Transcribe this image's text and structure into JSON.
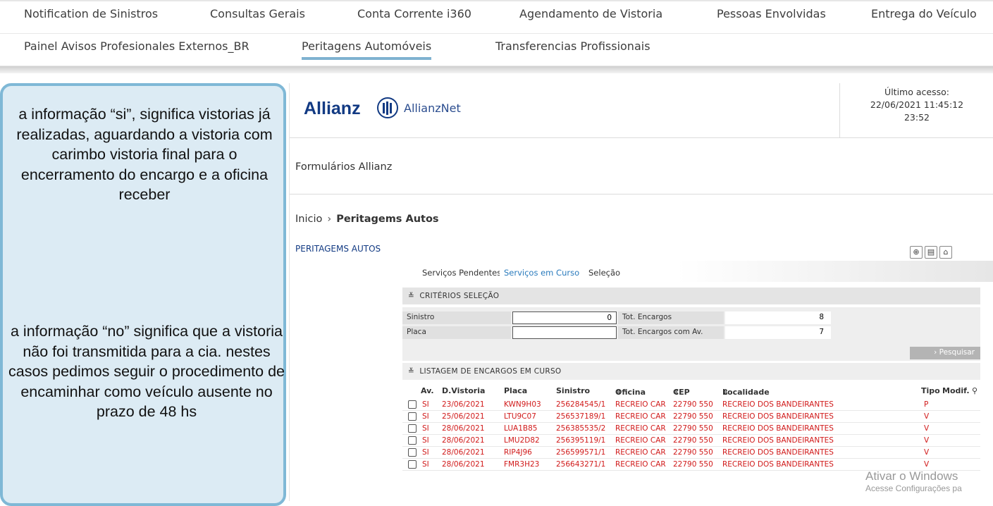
{
  "topnav": {
    "row1": [
      "Notification de Sinistros",
      "Consultas Gerais",
      "Conta Corrente i360",
      "Agendamento de Vistoria",
      "Pessoas Envolvidas",
      "Entrega do Veículo"
    ],
    "row2": [
      "Painel Avisos Profesionales Externos_BR",
      "Peritagens Automóveis",
      "Transferencias Profissionais"
    ],
    "active": "Peritagens Automóveis"
  },
  "callout": {
    "para1": "a informação “si”, significa vistorias já realizadas,  aguardando a vistoria com carimbo vistoria final  para o encerramento do encargo e a oficina receber",
    "para2": "a informação “no” significa que a vistoria não foi transmitida para a cia. nestes casos pedimos seguir o  procedimento de encaminhar como veículo ausente no prazo de 48 hs"
  },
  "header": {
    "brand": "Allianz",
    "app_name": "AllianzNet",
    "last_access_label": "Último acesso:",
    "last_access_datetime": "22/06/2021 11:45:12",
    "last_access_time": "23:52"
  },
  "forms_label": "Formulários Allianz",
  "breadcrumb": {
    "home": "Inicio",
    "current": "Peritagems Autos"
  },
  "section_title": "PERITAGEMS AUTOS",
  "tabs": [
    "Serviços Pendentes",
    "Serviços em Curso",
    "Seleção"
  ],
  "criteria": {
    "title": "CRITÉRIOS SELEÇÃO",
    "sinistro_label": "Sinistro",
    "sinistro_value": "0",
    "placa_label": "Placa",
    "placa_value": "",
    "tot_encargos_label": "Tot. Encargos",
    "tot_encargos_value": "8",
    "tot_av_label": "Tot. Encargos com Av.",
    "tot_av_value": "7",
    "search_button": "Pesquisar"
  },
  "listing": {
    "title": "LISTAGEM DE ENCARGOS EM CURSO",
    "columns": [
      "Av.",
      "D.Vistoria",
      "Placa",
      "Sinistro",
      "Oficina",
      "CEP",
      "Localidade",
      "Tipo",
      "Modif."
    ],
    "rows": [
      [
        "SI",
        "23/06/2021",
        "KWN9H03",
        "256284545/1",
        "RECREIO CAR",
        "22790 550",
        "RECREIO DOS BANDEIRANTES",
        "P"
      ],
      [
        "SI",
        "25/06/2021",
        "LTU9C07",
        "256537189/1",
        "RECREIO CAR",
        "22790 550",
        "RECREIO DOS BANDEIRANTES",
        "V"
      ],
      [
        "SI",
        "28/06/2021",
        "LUA1B85",
        "256385535/2",
        "RECREIO CAR",
        "22790 550",
        "RECREIO DOS BANDEIRANTES",
        "V"
      ],
      [
        "SI",
        "28/06/2021",
        "LMU2D82",
        "256395119/1",
        "RECREIO CAR",
        "22790 550",
        "RECREIO DOS BANDEIRANTES",
        "V"
      ],
      [
        "SI",
        "28/06/2021",
        "RIP4J96",
        "256599571/1",
        "RECREIO CAR",
        "22790 550",
        "RECREIO DOS BANDEIRANTES",
        "V"
      ],
      [
        "SI",
        "28/06/2021",
        "FMR3H23",
        "256643271/1",
        "RECREIO CAR",
        "22790 550",
        "RECREIO DOS BANDEIRANTES",
        "V"
      ]
    ]
  },
  "watermark": {
    "line1": "Ativar o Windows",
    "line2": "Acesse Configurações pa"
  },
  "colors": {
    "accent": "#2a7bbd",
    "brand": "#123a83",
    "row_text": "#d11a1a",
    "callout_bg": "#dcebf4",
    "callout_border": "#7fb8d6"
  }
}
